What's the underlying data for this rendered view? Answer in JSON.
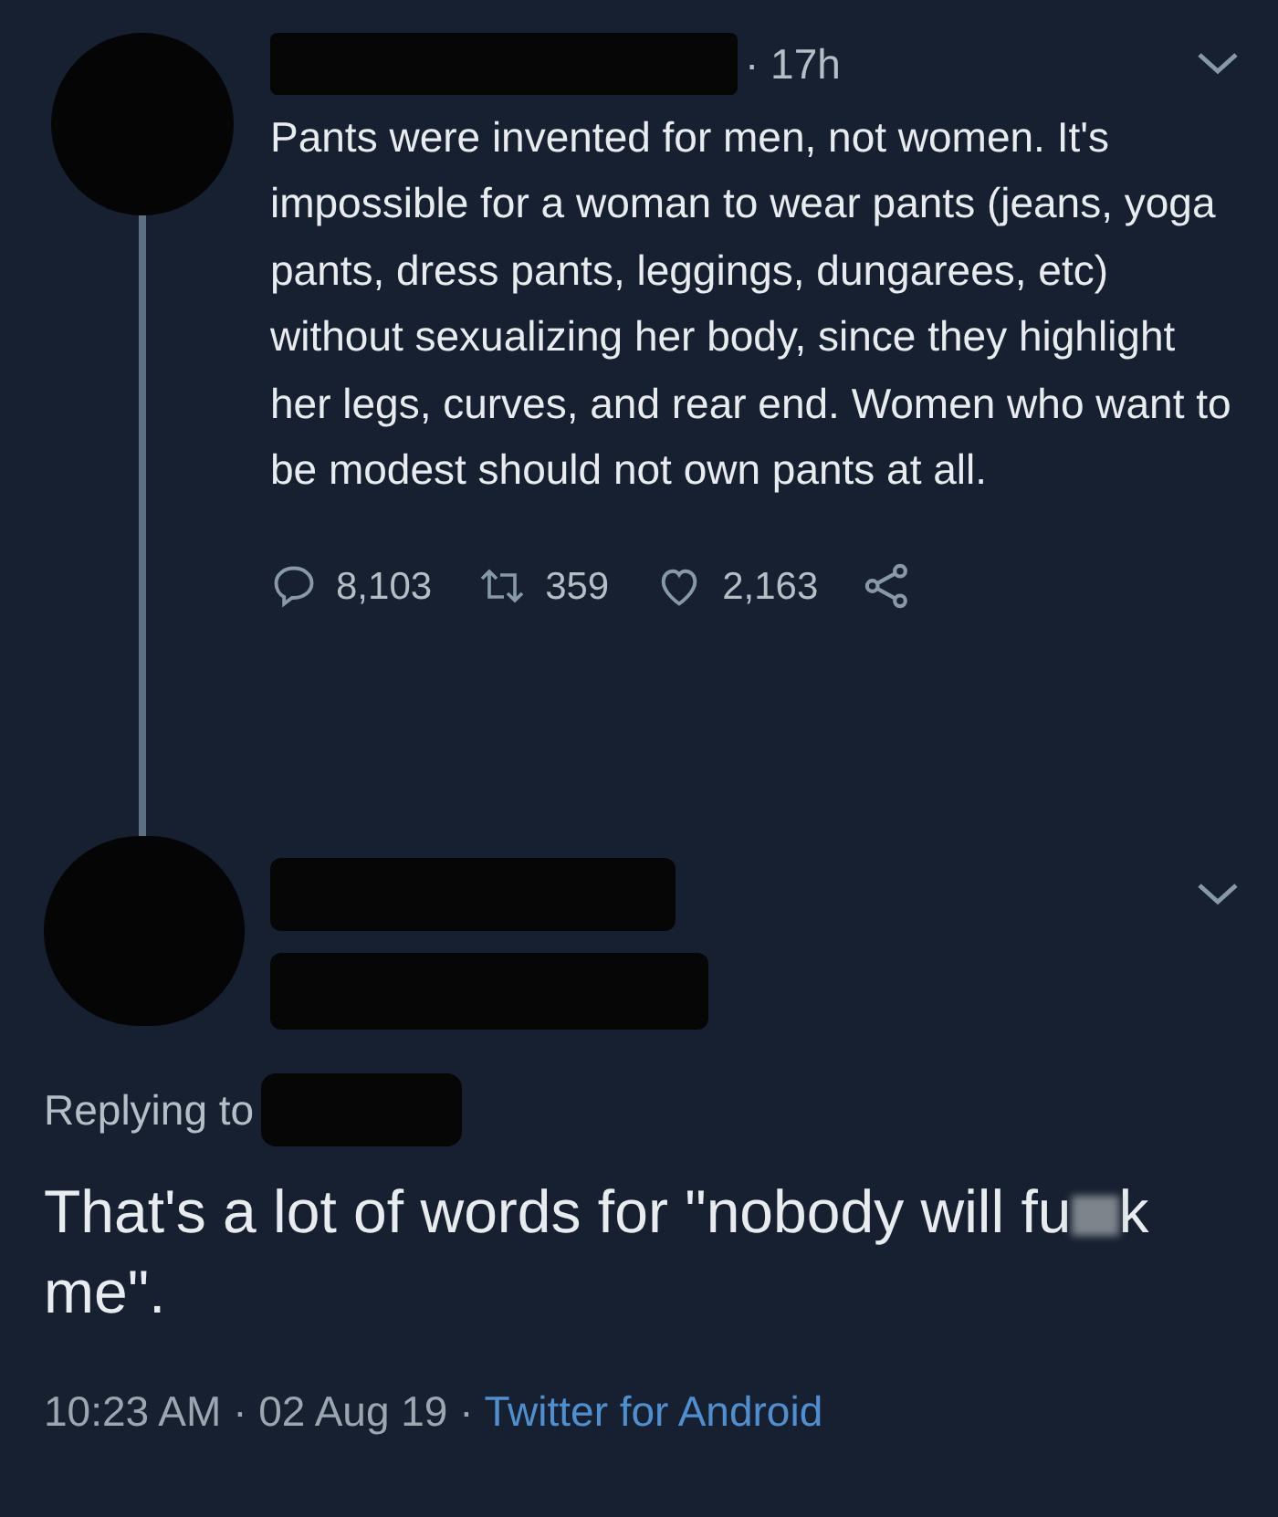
{
  "tweet": {
    "time": "· 17h",
    "text": "Pants were invented for men, not women. It's impossible for a woman to wear pants (jeans, yoga pants, dress pants, leggings, dungarees, etc) without sexualizing her body, since they highlight her legs, curves, and rear end. Women who want to be modest should not own pants at all.",
    "actions": [
      {
        "kind": "reply",
        "count": "8,103"
      },
      {
        "kind": "retweet",
        "count": "359"
      },
      {
        "kind": "like",
        "count": "2,163"
      },
      {
        "kind": "share"
      }
    ]
  },
  "reply": {
    "replying_to": "Replying to",
    "text_before": "That's a lot of words for \"nobody will fu",
    "text_after": "k me\".",
    "time": "10:23 AM · 02 Aug 19 · ",
    "source": "Twitter for Android"
  }
}
